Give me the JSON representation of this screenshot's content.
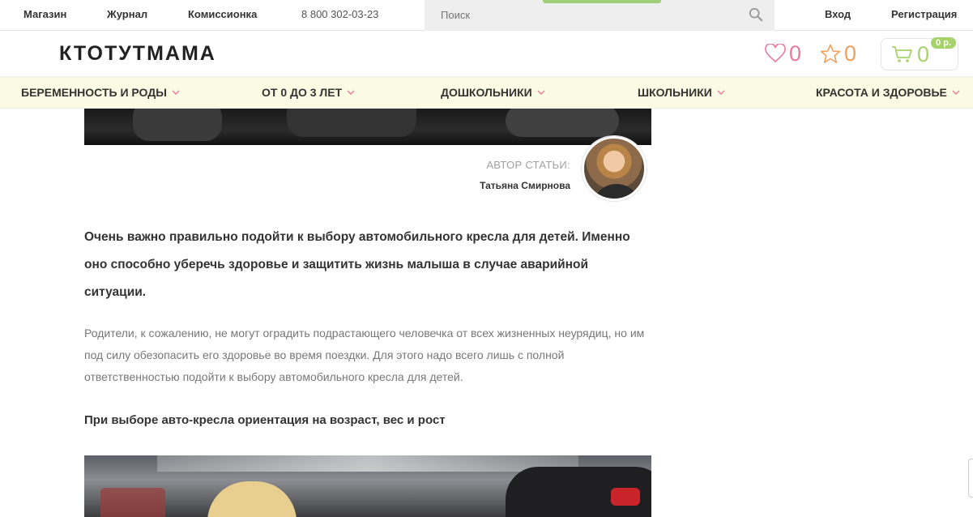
{
  "topbar": {
    "links": [
      "Магазин",
      "Журнал",
      "Комиссионка"
    ],
    "phone": "8 800 302-03-23",
    "search_placeholder": "Поиск",
    "login": "Вход",
    "register": "Регистрация"
  },
  "header": {
    "logo": "КТОТУТМАМА",
    "favorites_count": "0",
    "wishlist_count": "0",
    "cart_count": "0",
    "cart_total": "0 р."
  },
  "categories": [
    "БЕРЕМЕННОСТЬ И РОДЫ",
    "ОТ 0 ДО 3 ЛЕТ",
    "ДОШКОЛЬНИКИ",
    "ШКОЛЬНИКИ",
    "КРАСОТА И ЗДОРОВЬЕ"
  ],
  "article": {
    "author_label": "АВТОР СТАТЬИ:",
    "author_name": "Татьяна Смирнова",
    "lead": "Очень важно правильно подойти к выбору автомобильного кресла для детей. Именно оно способно уберечь здоровье и защитить жизнь малыша в случае аварийной ситуации.",
    "paragraph": "Родители, к сожалению, не могут оградить подрастающего человечка от всех жизненных неурядиц, но им под силу обезопасить его здоровье во время поездки. Для этого надо всего лишь с полной ответственностью подойти к выбору автомобильного кресла для детей.",
    "subheading": "При выборе авто-кресла ориентация на возраст, вес и рост"
  },
  "colors": {
    "accent_green": "#a6d26a",
    "heart_pink": "#e87a9c",
    "star_orange": "#f0a05a",
    "nav_bg": "#fbfbe4",
    "chevron_pink": "#e87a9c"
  }
}
